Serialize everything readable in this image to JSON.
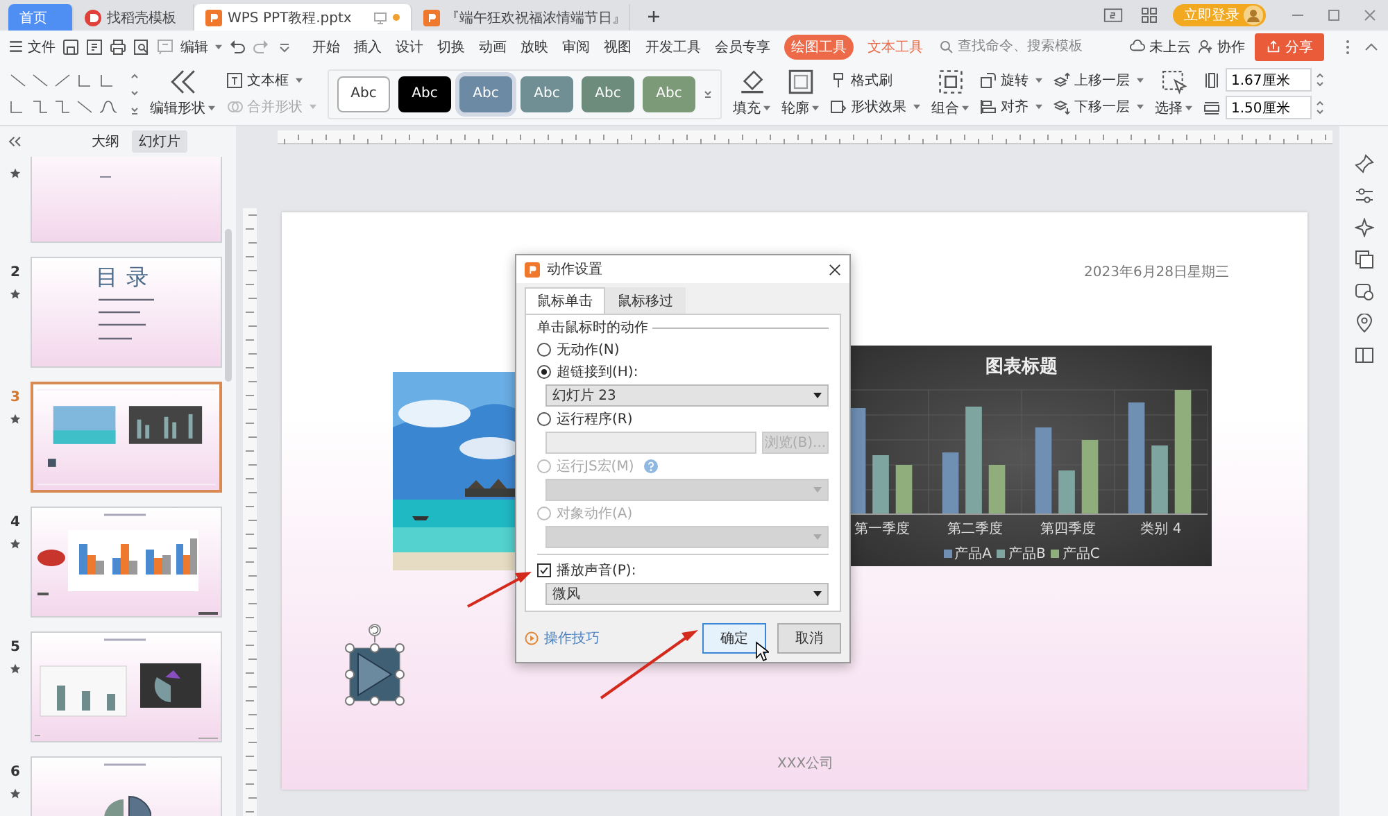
{
  "tabs": [
    {
      "label": "首页",
      "kind": "home",
      "selected": false
    },
    {
      "label": "找稻壳模板",
      "kind": "docer",
      "selected": false
    },
    {
      "label": "WPS PPT教程.pptx",
      "kind": "ppt",
      "selected": true
    },
    {
      "label": "『端午狂欢祝福浓情端节日』",
      "kind": "ppt",
      "selected": false
    }
  ],
  "login": "立即登录",
  "menu": {
    "file": "文件",
    "edit": "编辑",
    "items": [
      {
        "label": "开始",
        "kind": "plain",
        "selected": false
      },
      {
        "label": "插入",
        "kind": "plain",
        "selected": false
      },
      {
        "label": "设计",
        "kind": "plain",
        "selected": false
      },
      {
        "label": "切换",
        "kind": "plain",
        "selected": false
      },
      {
        "label": "动画",
        "kind": "plain",
        "selected": false
      },
      {
        "label": "放映",
        "kind": "plain",
        "selected": false
      },
      {
        "label": "审阅",
        "kind": "plain",
        "selected": false
      },
      {
        "label": "视图",
        "kind": "plain",
        "selected": false
      },
      {
        "label": "开发工具",
        "kind": "plain",
        "selected": false
      },
      {
        "label": "会员专享",
        "kind": "plain",
        "selected": false
      },
      {
        "label": "绘图工具",
        "kind": "context",
        "selected": true
      },
      {
        "label": "文本工具",
        "kind": "context",
        "selected": false
      }
    ],
    "search": {
      "placeholder": "查找命令、搜索模板"
    },
    "cloud": "未上云",
    "collab": "协作",
    "share": "分享"
  },
  "ribbon": {
    "edit_shape": "编辑形状",
    "text_box": "文本框",
    "merge_shape": "合并形状",
    "styles": [
      {
        "label": "Abc",
        "color": "#ffffff",
        "selected": false
      },
      {
        "label": "Abc",
        "color": "#000000",
        "selected": false
      },
      {
        "label": "Abc",
        "color": "#6d8aa4",
        "selected": true
      },
      {
        "label": "Abc",
        "color": "#6f8f94",
        "selected": false
      },
      {
        "label": "Abc",
        "color": "#6d8c7c",
        "selected": false
      },
      {
        "label": "Abc",
        "color": "#7c9a77",
        "selected": false
      }
    ],
    "fill": "填充",
    "outline": "轮廓",
    "format_painter": "格式刷",
    "shape_effects": "形状效果",
    "group": "组合",
    "rotate": "旋转",
    "align": "对齐",
    "bring_forward": "上移一层",
    "send_backward": "下移一层",
    "select": "选择",
    "height": "1.67厘米",
    "width": "1.50厘米"
  },
  "panel": {
    "tabs": [
      {
        "label": "大纲",
        "selected": false
      },
      {
        "label": "幻灯片",
        "selected": true
      }
    ],
    "slides": [
      {
        "kind": "cover",
        "selected": false
      },
      {
        "number": "2",
        "kind": "toc",
        "title": "目录",
        "selected": false
      },
      {
        "number": "3",
        "kind": "current",
        "selected": true
      },
      {
        "number": "4",
        "kind": "chart",
        "selected": false
      },
      {
        "number": "5",
        "kind": "chart2",
        "selected": false
      },
      {
        "number": "6",
        "kind": "pie",
        "selected": false
      }
    ]
  },
  "slide": {
    "date": "2023年6月28日星期三",
    "company": "XXX公司",
    "chart": {
      "title": "图表标题",
      "categories": [
        "第一季度",
        "第二季度",
        "第四季度",
        "类别 4"
      ],
      "legend": [
        {
          "name": "产品A",
          "color": "#6f8fb3"
        },
        {
          "name": "产品B",
          "color": "#7fa5a0"
        },
        {
          "name": "产品C",
          "color": "#8fae7c"
        }
      ]
    }
  },
  "dialog": {
    "title": "动作设置",
    "tabs": [
      {
        "label": "鼠标单击",
        "selected": true
      },
      {
        "label": "鼠标移过",
        "selected": false
      }
    ],
    "group": "单击鼠标时的动作",
    "options": [
      {
        "label": "无动作(N)",
        "selected": false,
        "disabled": false
      },
      {
        "label": "超链接到(H):",
        "selected": true,
        "disabled": false,
        "field": {
          "kind": "select",
          "value": "幻灯片 23",
          "disabled": false
        }
      },
      {
        "label": "运行程序(R)",
        "selected": false,
        "disabled": false,
        "field": {
          "kind": "input",
          "button": "浏览(B)...",
          "disabled": false
        }
      },
      {
        "label": "运行JS宏(M)",
        "selected": false,
        "disabled": true,
        "help": true,
        "field": {
          "kind": "select",
          "disabled": true
        }
      },
      {
        "label": "对象动作(A)",
        "selected": false,
        "disabled": true,
        "field": {
          "kind": "select",
          "disabled": true
        }
      }
    ],
    "sound": {
      "label": "播放声音(P):",
      "checked": true,
      "value": "微风"
    },
    "tips": "操作技巧",
    "ok": "确定",
    "cancel": "取消"
  }
}
